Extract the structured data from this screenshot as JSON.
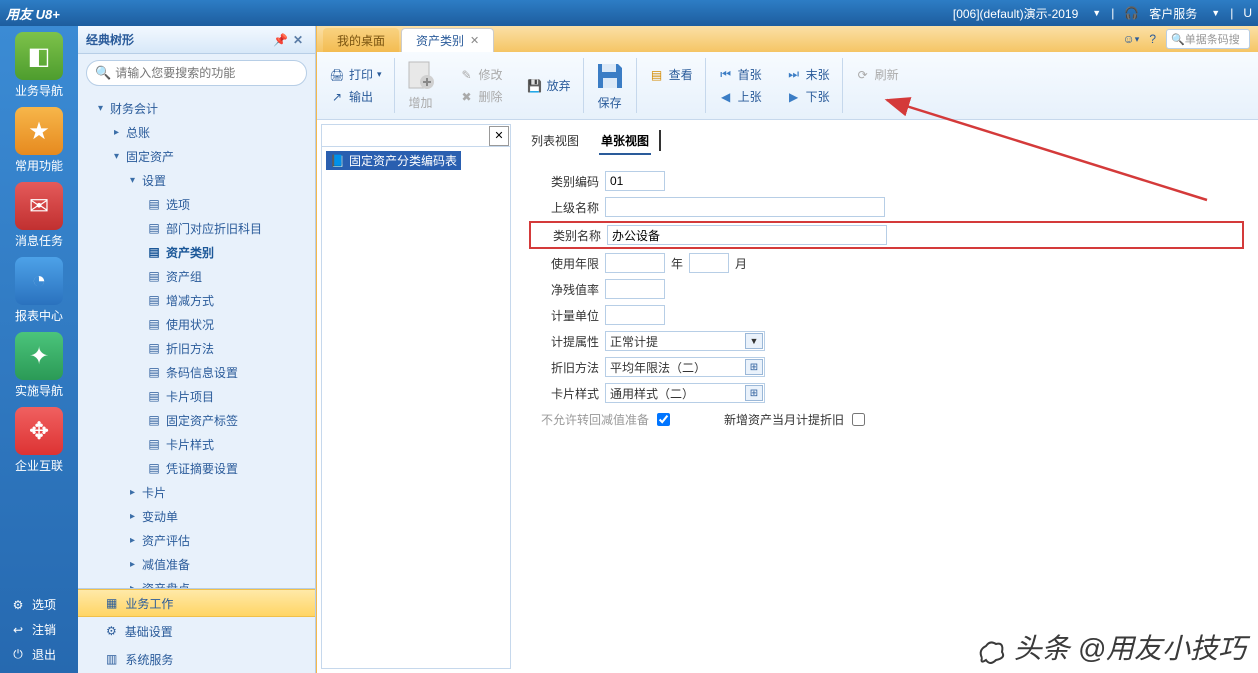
{
  "top": {
    "logo": "用友 U8+",
    "env": "[006](default)演示-2019",
    "service": "客户服务",
    "u": "U"
  },
  "rail": {
    "items": [
      "业务导航",
      "常用功能",
      "消息任务",
      "报表中心",
      "实施导航",
      "企业互联"
    ],
    "bottom": [
      "选项",
      "注销",
      "退出"
    ]
  },
  "nav": {
    "title": "经典树形",
    "search_placeholder": "请输入您要搜索的功能",
    "root": "财务会计",
    "l1a": "总账",
    "l1b": "固定资产",
    "l2a": "设置",
    "leaves": [
      "选项",
      "部门对应折旧科目",
      "资产类别",
      "资产组",
      "增减方式",
      "使用状况",
      "折旧方法",
      "条码信息设置",
      "卡片项目",
      "固定资产标签",
      "卡片样式",
      "凭证摘要设置"
    ],
    "l2b": "卡片",
    "l2c": "变动单",
    "l2d": "资产评估",
    "l2e": "减值准备",
    "l2f": "资产盘点",
    "bottom": [
      "业务工作",
      "基础设置",
      "系统服务"
    ]
  },
  "tabs": {
    "desktop": "我的桌面",
    "current": "资产类别"
  },
  "tabright": {
    "search_placeholder": "单据条码搜"
  },
  "toolbar": {
    "print": "打印",
    "output": "输出",
    "add": "增加",
    "delete": "删除",
    "modify": "修改",
    "discard": "放弃",
    "save": "保存",
    "view": "查看",
    "first": "首张",
    "last": "末张",
    "prev": "上张",
    "next": "下张",
    "refresh": "刷新"
  },
  "lefttree": {
    "root": "固定资产分类编码表"
  },
  "views": {
    "list": "列表视图",
    "single": "单张视图"
  },
  "form": {
    "code_label": "类别编码",
    "code_value": "01",
    "parent_label": "上级名称",
    "parent_value": "",
    "name_label": "类别名称",
    "name_value": "办公设备",
    "life_label": "使用年限",
    "life_years": "",
    "life_months": "",
    "year_unit": "年",
    "month_unit": "月",
    "salvage_label": "净残值率",
    "salvage_value": "",
    "unit_label": "计量单位",
    "unit_value": "",
    "accrual_label": "计提属性",
    "accrual_value": "正常计提",
    "method_label": "折旧方法",
    "method_value": "平均年限法（二）",
    "style_label": "卡片样式",
    "style_value": "通用样式（二）",
    "noreturn_label": "不允许转回减值准备",
    "newasset_label": "新增资产当月计提折旧"
  },
  "watermark": {
    "prefix": "头条",
    "text": "@用友小技巧"
  }
}
